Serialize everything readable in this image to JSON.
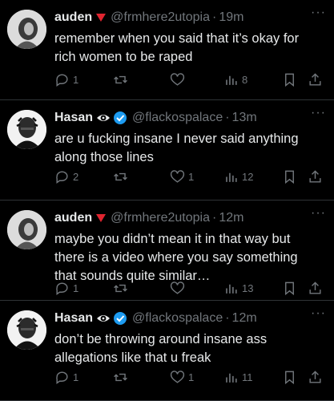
{
  "tweets": [
    {
      "name": "auden",
      "badge": "red-triangle-icon",
      "handle": "@frmhere2utopia",
      "time": "19m",
      "text": "remember when you said that it’s okay for rich women to be raped",
      "replies": "1",
      "retweets": "",
      "likes": "",
      "views": "8"
    },
    {
      "name": "Hasan",
      "badge": "eye-and-verified-icon",
      "handle": "@flackospalace",
      "time": "13m",
      "text": "are u fucking insane I never said anything along those lines",
      "replies": "2",
      "retweets": "",
      "likes": "1",
      "views": "12"
    },
    {
      "name": "auden",
      "badge": "red-triangle-icon",
      "handle": "@frmhere2utopia",
      "time": "12m",
      "text": "maybe you didn’t mean it in that way but there is a video where you say something that sounds quite similar…",
      "replies": "1",
      "retweets": "",
      "likes": "",
      "views": "13"
    },
    {
      "name": "Hasan",
      "badge": "eye-and-verified-icon",
      "handle": "@flackospalace",
      "time": "12m",
      "text": "don’t be throwing around insane ass allegations like that u freak",
      "replies": "1",
      "retweets": "",
      "likes": "1",
      "views": "11"
    }
  ],
  "colors": {
    "background": "#000000",
    "muted": "#71767b",
    "verified": "#1d9bf0",
    "badge_red": "#e0242f"
  }
}
